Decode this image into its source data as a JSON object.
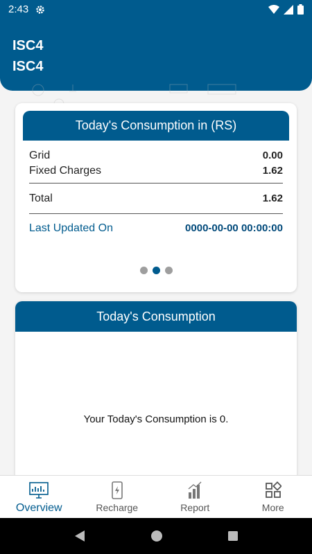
{
  "status_bar": {
    "time": "2:43"
  },
  "header": {
    "line1": "ISC4",
    "line2": "ISC4"
  },
  "consumption_card": {
    "title": "Today's Consumption in (RS)",
    "rows": [
      {
        "label": "Grid",
        "value": "0.00"
      },
      {
        "label": "Fixed Charges",
        "value": "1.62"
      }
    ],
    "total_label": "Total",
    "total_value": "1.62",
    "updated_label": "Last Updated On",
    "updated_value": "0000-00-00 00:00:00",
    "pager": {
      "pages": 3,
      "active": 2
    }
  },
  "today_card": {
    "title": "Today's Consumption",
    "message": "Your Today's Consumption is 0."
  },
  "bottom_nav": {
    "items": [
      {
        "label": "Overview",
        "icon": "monitor-chart-icon",
        "active": true
      },
      {
        "label": "Recharge",
        "icon": "phone-charge-icon",
        "active": false
      },
      {
        "label": "Report",
        "icon": "bar-chart-icon",
        "active": false
      },
      {
        "label": "More",
        "icon": "grid-icon",
        "active": false
      }
    ]
  },
  "colors": {
    "primary": "#005b8e",
    "background": "#f4f4f4"
  }
}
